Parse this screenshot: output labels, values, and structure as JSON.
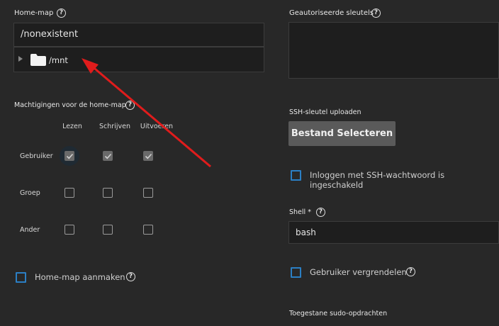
{
  "left": {
    "home_dir_label": "Home-map",
    "home_dir_value": "/nonexistent",
    "tree_item": "/mnt",
    "perms_label": "Machtigingen voor de home-map",
    "perm_columns": [
      "Lezen",
      "Schrijven",
      "Uitvoeren"
    ],
    "perm_rows": [
      "Gebruiker",
      "Groep",
      "Ander"
    ],
    "create_home_label": "Home-map aanmaken"
  },
  "right": {
    "auth_keys_label": "Geautoriseerde sleutels",
    "ssh_upload_label": "SSH-sleutel uploaden",
    "select_file_button": "Bestand Selecteren",
    "ssh_password_label": "Inloggen met SSH-wachtwoord is ingeschakeld",
    "shell_label": "Shell *",
    "shell_value": "bash",
    "lock_user_label": "Gebruiker vergrendelen",
    "sudo_label": "Toegestane sudo-opdrachten"
  },
  "colors": {
    "accent": "#2b7fc4",
    "annotation_arrow": "#e01c1c"
  },
  "icons": {
    "help": "help-icon",
    "folder": "folder-icon",
    "expand": "expand-arrow-icon",
    "check": "check-icon"
  },
  "help_glyph": "?"
}
